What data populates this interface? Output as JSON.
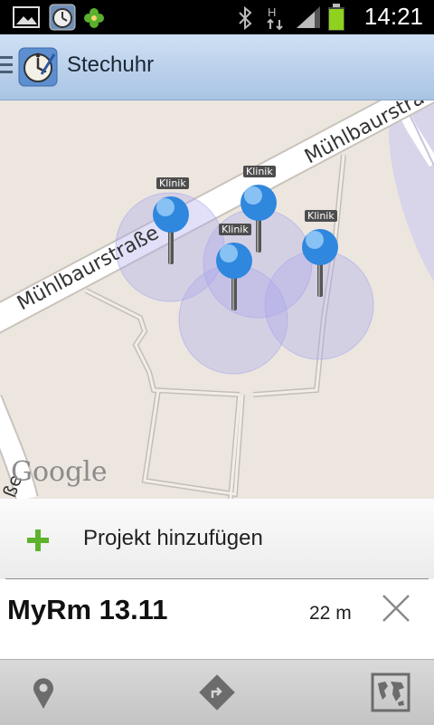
{
  "status_bar": {
    "time": "14:21",
    "battery_color": "#8ed21d",
    "icons": [
      "gallery-icon",
      "stechuhr-notification-icon",
      "clover-icon",
      "bluetooth-icon",
      "hspa-icon",
      "signal-icon",
      "battery-icon"
    ]
  },
  "app_bar": {
    "title": "Stechuhr",
    "icon": "clock-icon"
  },
  "map": {
    "street_label": "Mühlbaurstraße",
    "street_label_partial": "Mühlbaurstra",
    "provider_logo": "Google",
    "markers": [
      {
        "label": "Klinik"
      },
      {
        "label": "Klinik"
      },
      {
        "label": "Klinik"
      },
      {
        "label": "Klinik"
      }
    ]
  },
  "add_project": {
    "label": "Projekt hinzufügen",
    "icon": "plus-icon",
    "accent": "#5db32d"
  },
  "project": {
    "name": "MyRm 13.11",
    "distance": "22 m"
  },
  "bottom_bar": {
    "buttons": [
      "location-pin-icon",
      "directions-icon",
      "world-map-icon"
    ]
  }
}
